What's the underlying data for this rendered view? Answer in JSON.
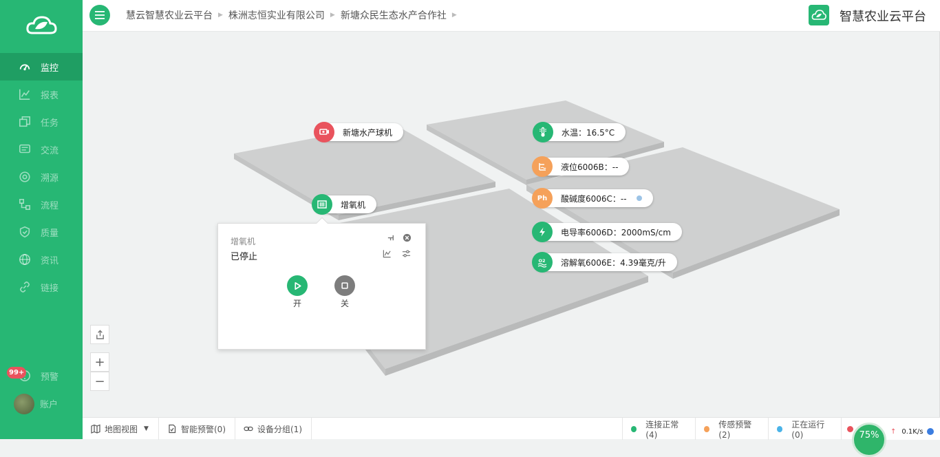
{
  "sidebar": {
    "items": [
      {
        "label": "监控",
        "icon": "dashboard-icon"
      },
      {
        "label": "报表",
        "icon": "chart-icon"
      },
      {
        "label": "任务",
        "icon": "task-icon"
      },
      {
        "label": "交流",
        "icon": "chat-icon"
      },
      {
        "label": "溯源",
        "icon": "trace-icon"
      },
      {
        "label": "流程",
        "icon": "flow-icon"
      },
      {
        "label": "质量",
        "icon": "shield-icon"
      },
      {
        "label": "资讯",
        "icon": "globe-icon"
      },
      {
        "label": "链接",
        "icon": "link-icon"
      }
    ],
    "alerts": {
      "label": "预警",
      "badge": "99+"
    },
    "account": {
      "label": "账户"
    }
  },
  "header": {
    "breadcrumbs": [
      "慧云智慧农业云平台",
      "株洲志恒实业有限公司",
      "新塘众民生态水产合作社"
    ],
    "brand_title": "智慧农业云平台"
  },
  "map": {
    "labels": [
      {
        "text": "新塘水产球机",
        "icon": "camera-icon",
        "color": "#e9535d"
      },
      {
        "text": "增氧机",
        "icon": "aerator-icon",
        "color": "#27b774"
      },
      {
        "text": "水温：16.5°C",
        "icon": "thermometer-icon",
        "color": "#27b774"
      },
      {
        "text": "液位6006B：--",
        "icon": "water-level-icon",
        "color": "#f5a15a"
      },
      {
        "text": "酸碱度6006C：--",
        "icon": "ph-icon",
        "icon_text": "Ph",
        "color": "#f5a15a"
      },
      {
        "text": "电导率6006D：2000mS/cm",
        "icon": "bolt-icon",
        "color": "#27b774"
      },
      {
        "text": "溶解氧6006E：4.39毫克/升",
        "icon": "oxygen-icon",
        "color": "#27b774"
      }
    ],
    "popup": {
      "title": "增氧机",
      "status": "已停止",
      "on_label": "开",
      "off_label": "关"
    },
    "zoom_in": "+",
    "zoom_out": "−"
  },
  "bottom_bar": {
    "map_view": "地图视图",
    "smart_alert": "智能预警(0)",
    "device_group": "设备分组(1)",
    "statuses": [
      {
        "label": "连接正常(4)",
        "color": "#27b774"
      },
      {
        "label": "传感预警(2)",
        "color": "#f5a15a"
      },
      {
        "label": "正在运行(0)",
        "color": "#4ab3e8"
      }
    ],
    "gauge": "75%",
    "net_speed": "0.1K/s"
  }
}
